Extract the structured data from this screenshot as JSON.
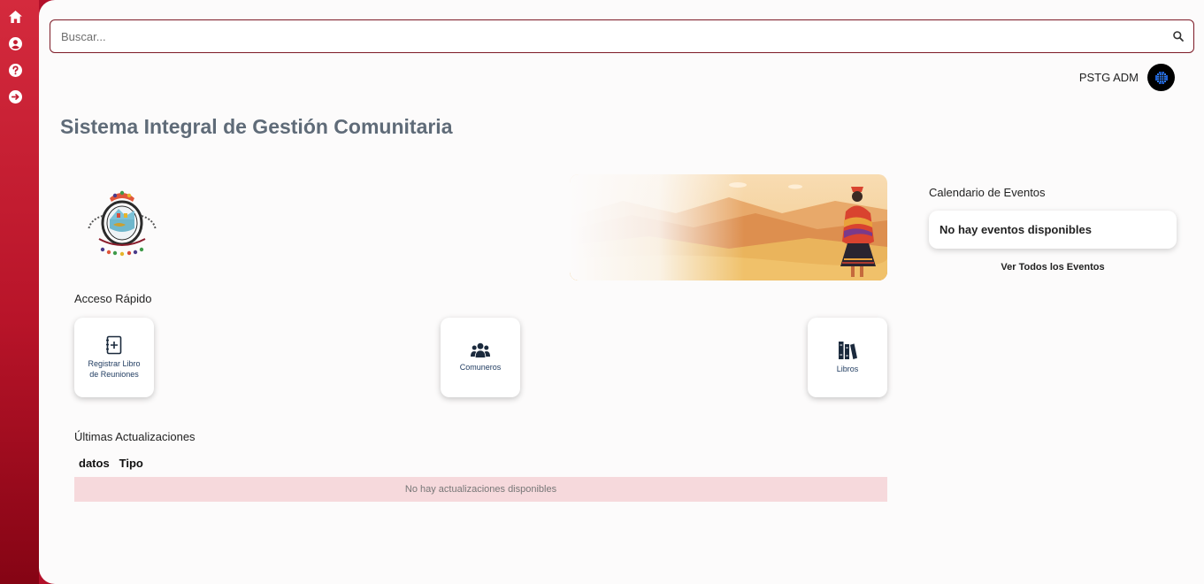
{
  "sidebar": {
    "items": [
      {
        "icon": "home-icon"
      },
      {
        "icon": "user-circle-icon"
      },
      {
        "icon": "help-circle-icon"
      },
      {
        "icon": "logout-icon"
      }
    ]
  },
  "search": {
    "placeholder": "Buscar...",
    "value": ""
  },
  "user": {
    "name": "PSTG ADM"
  },
  "page_title": "Sistema Integral de Gestión Comunitaria",
  "quick_access": {
    "title": "Acceso Rápido",
    "cards": [
      {
        "label": "Registrar Libro de Reuniones",
        "icon": "add-book-icon"
      },
      {
        "label": "Comuneros",
        "icon": "users-icon"
      },
      {
        "label": "Libros",
        "icon": "books-icon"
      }
    ]
  },
  "updates": {
    "title": "Últimas Actualizaciones",
    "columns": [
      "datos",
      "Tipo"
    ],
    "empty_text": "No hay actualizaciones disponibles"
  },
  "calendar": {
    "title": "Calendario de Eventos",
    "empty_text": "No hay eventos disponibles",
    "view_all": "Ver Todos los Eventos"
  },
  "colors": {
    "sidebar": "#b81429",
    "accent": "#7d1a26",
    "title": "#5f6b78",
    "empty_row": "#f6d9dc"
  }
}
